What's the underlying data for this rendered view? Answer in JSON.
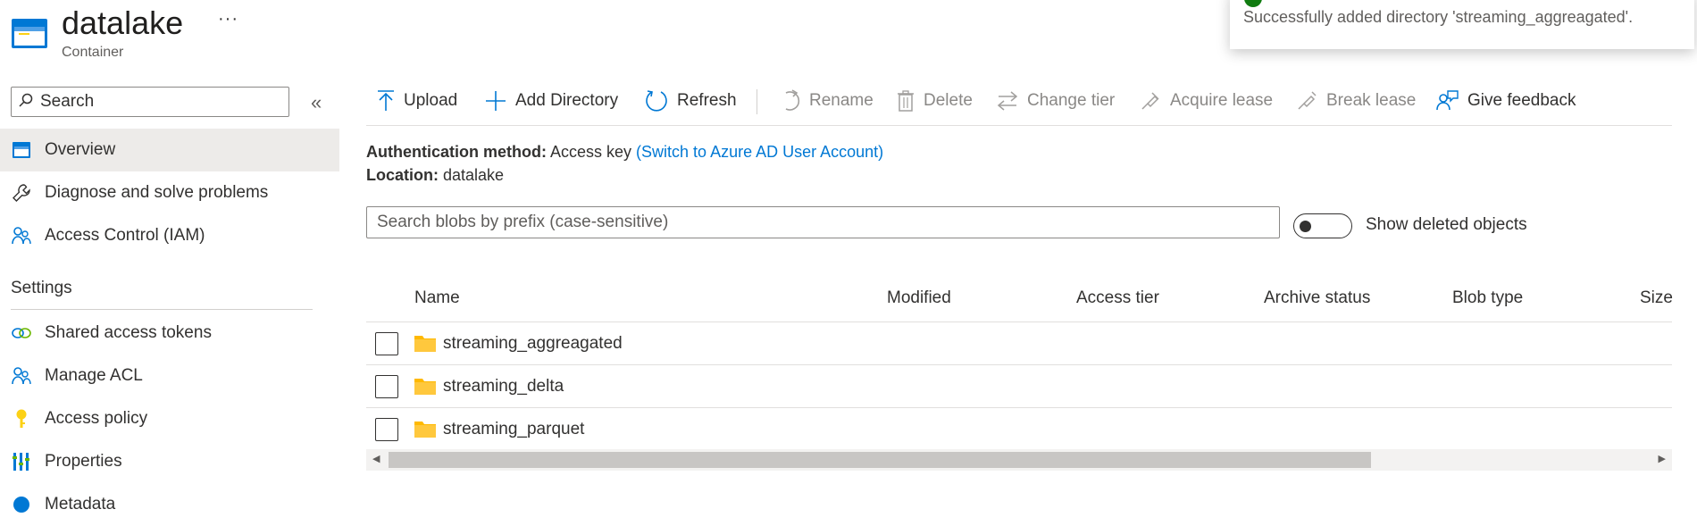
{
  "header": {
    "title": "datalake",
    "subtitle": "Container",
    "more_label": "···"
  },
  "sidebar": {
    "search_placeholder": "Search",
    "collapse_label": "«",
    "items": [
      {
        "label": "Overview",
        "icon": "container-icon"
      },
      {
        "label": "Diagnose and solve problems",
        "icon": "wrench-icon"
      },
      {
        "label": "Access Control (IAM)",
        "icon": "people-icon"
      }
    ],
    "settings_heading": "Settings",
    "settings_items": [
      {
        "label": "Shared access tokens",
        "icon": "link-icon"
      },
      {
        "label": "Manage ACL",
        "icon": "people-icon"
      },
      {
        "label": "Access policy",
        "icon": "key-icon"
      },
      {
        "label": "Properties",
        "icon": "properties-icon"
      },
      {
        "label": "Metadata",
        "icon": "info-icon"
      }
    ]
  },
  "toolbar": {
    "upload": "Upload",
    "add_directory": "Add Directory",
    "refresh": "Refresh",
    "rename": "Rename",
    "delete": "Delete",
    "change_tier": "Change tier",
    "acquire_lease": "Acquire lease",
    "break_lease": "Break lease",
    "give_feedback": "Give feedback"
  },
  "info": {
    "auth_label": "Authentication method:",
    "auth_value": "Access key",
    "auth_link": "(Switch to Azure AD User Account)",
    "location_label": "Location:",
    "location_value": "datalake"
  },
  "blob_search": {
    "placeholder": "Search blobs by prefix (case-sensitive)"
  },
  "toggle": {
    "label": "Show deleted objects",
    "on": false
  },
  "table": {
    "columns": [
      "Name",
      "Modified",
      "Access tier",
      "Archive status",
      "Blob type",
      "Size"
    ],
    "rows": [
      {
        "name": "streaming_aggreagated"
      },
      {
        "name": "streaming_delta"
      },
      {
        "name": "streaming_parquet"
      }
    ]
  },
  "toast": {
    "message": "Successfully added directory 'streaming_aggreagated'."
  },
  "colors": {
    "accent": "#0078d4",
    "folder": "#ffb900",
    "success": "#107c10",
    "active_nav": "#edebe9"
  }
}
